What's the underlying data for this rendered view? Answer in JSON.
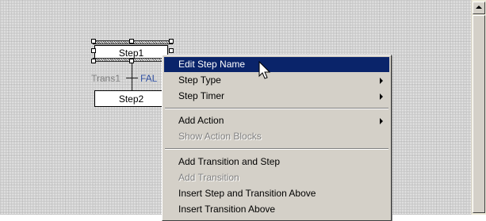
{
  "diagram": {
    "steps": [
      {
        "label": "Step1"
      },
      {
        "label": "Step2"
      }
    ],
    "transition": {
      "name": "Trans1",
      "condition": "FAL"
    }
  },
  "context_menu": {
    "items": [
      {
        "label": "Edit Step Name",
        "highlighted": true,
        "submenu": false,
        "enabled": true
      },
      {
        "label": "Step Type",
        "highlighted": false,
        "submenu": true,
        "enabled": true
      },
      {
        "label": "Step Timer",
        "highlighted": false,
        "submenu": true,
        "enabled": true
      },
      {
        "label": "Add Action",
        "highlighted": false,
        "submenu": true,
        "enabled": true
      },
      {
        "label": "Show Action Blocks",
        "highlighted": false,
        "submenu": false,
        "enabled": false
      },
      {
        "label": "Add Transition and Step",
        "highlighted": false,
        "submenu": false,
        "enabled": true
      },
      {
        "label": "Add Transition",
        "highlighted": false,
        "submenu": false,
        "enabled": false
      },
      {
        "label": "Insert Step and Transition Above",
        "highlighted": false,
        "submenu": false,
        "enabled": true
      },
      {
        "label": "Insert Transition Above",
        "highlighted": false,
        "submenu": false,
        "enabled": true
      }
    ]
  },
  "icons": {
    "scroll_up": "scroll-up-arrow-icon",
    "submenu_arrow": "submenu-arrow-icon",
    "cursor": "mouse-pointer-icon"
  },
  "colors": {
    "highlight": "#0a246a",
    "menu_bg": "#d4d0c8",
    "transition_condition": "#3050a0"
  }
}
